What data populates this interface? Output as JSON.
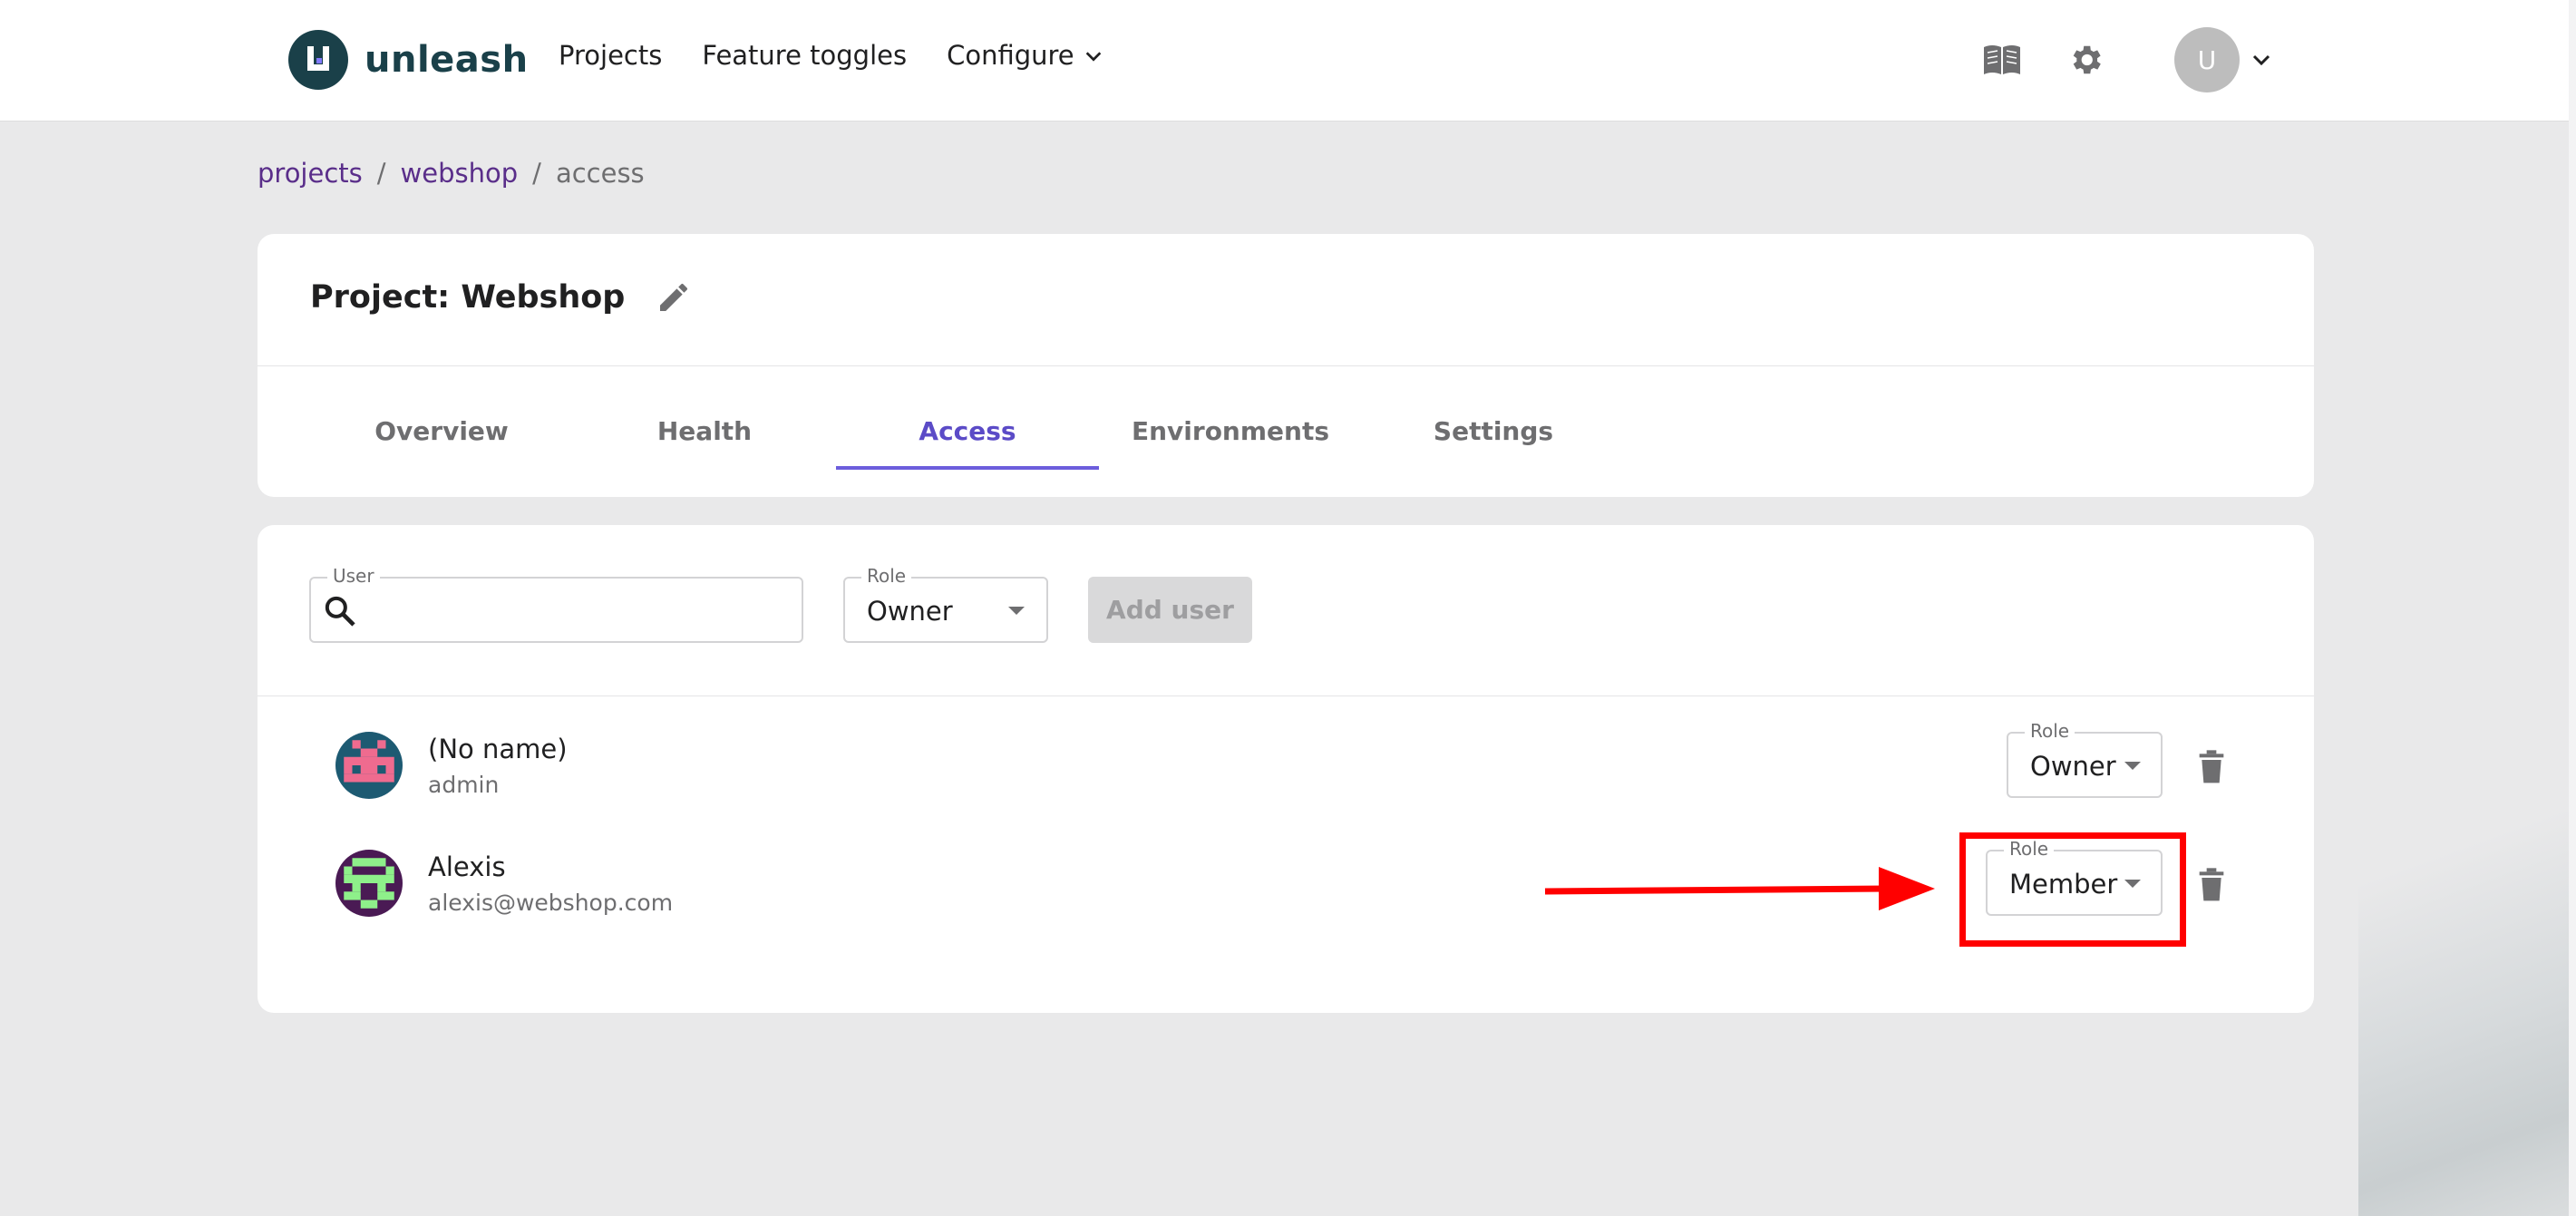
{
  "app": {
    "logo_text": "unleash"
  },
  "nav": {
    "projects": "Projects",
    "feature_toggles": "Feature toggles",
    "configure": "Configure"
  },
  "header": {
    "avatar_initial": "U",
    "icons": [
      "docs-book-icon",
      "settings-gear-icon",
      "chevron-down-icon"
    ]
  },
  "breadcrumb": {
    "projects": "projects",
    "sep1": "/",
    "project": "webshop",
    "sep2": "/",
    "current": "access"
  },
  "project": {
    "title": "Project: Webshop",
    "tabs": [
      {
        "label": "Overview",
        "active": false
      },
      {
        "label": "Health",
        "active": false
      },
      {
        "label": "Access",
        "active": true
      },
      {
        "label": "Environments",
        "active": false
      },
      {
        "label": "Settings",
        "active": false
      }
    ]
  },
  "access": {
    "user_field_label": "User",
    "user_field_value": "",
    "role_field_label": "Role",
    "role_field_value": "Owner",
    "add_user_label": "Add user",
    "users": [
      {
        "name": "(No name)",
        "sub": "admin",
        "role_label": "Role",
        "role": "Owner"
      },
      {
        "name": "Alexis",
        "sub": "alexis@webshop.com",
        "role_label": "Role",
        "role": "Member"
      }
    ]
  },
  "colors": {
    "accent": "#6c5ddc",
    "brand": "#1a4049",
    "link": "#5a2e8a",
    "annotation": "#ff0000"
  }
}
